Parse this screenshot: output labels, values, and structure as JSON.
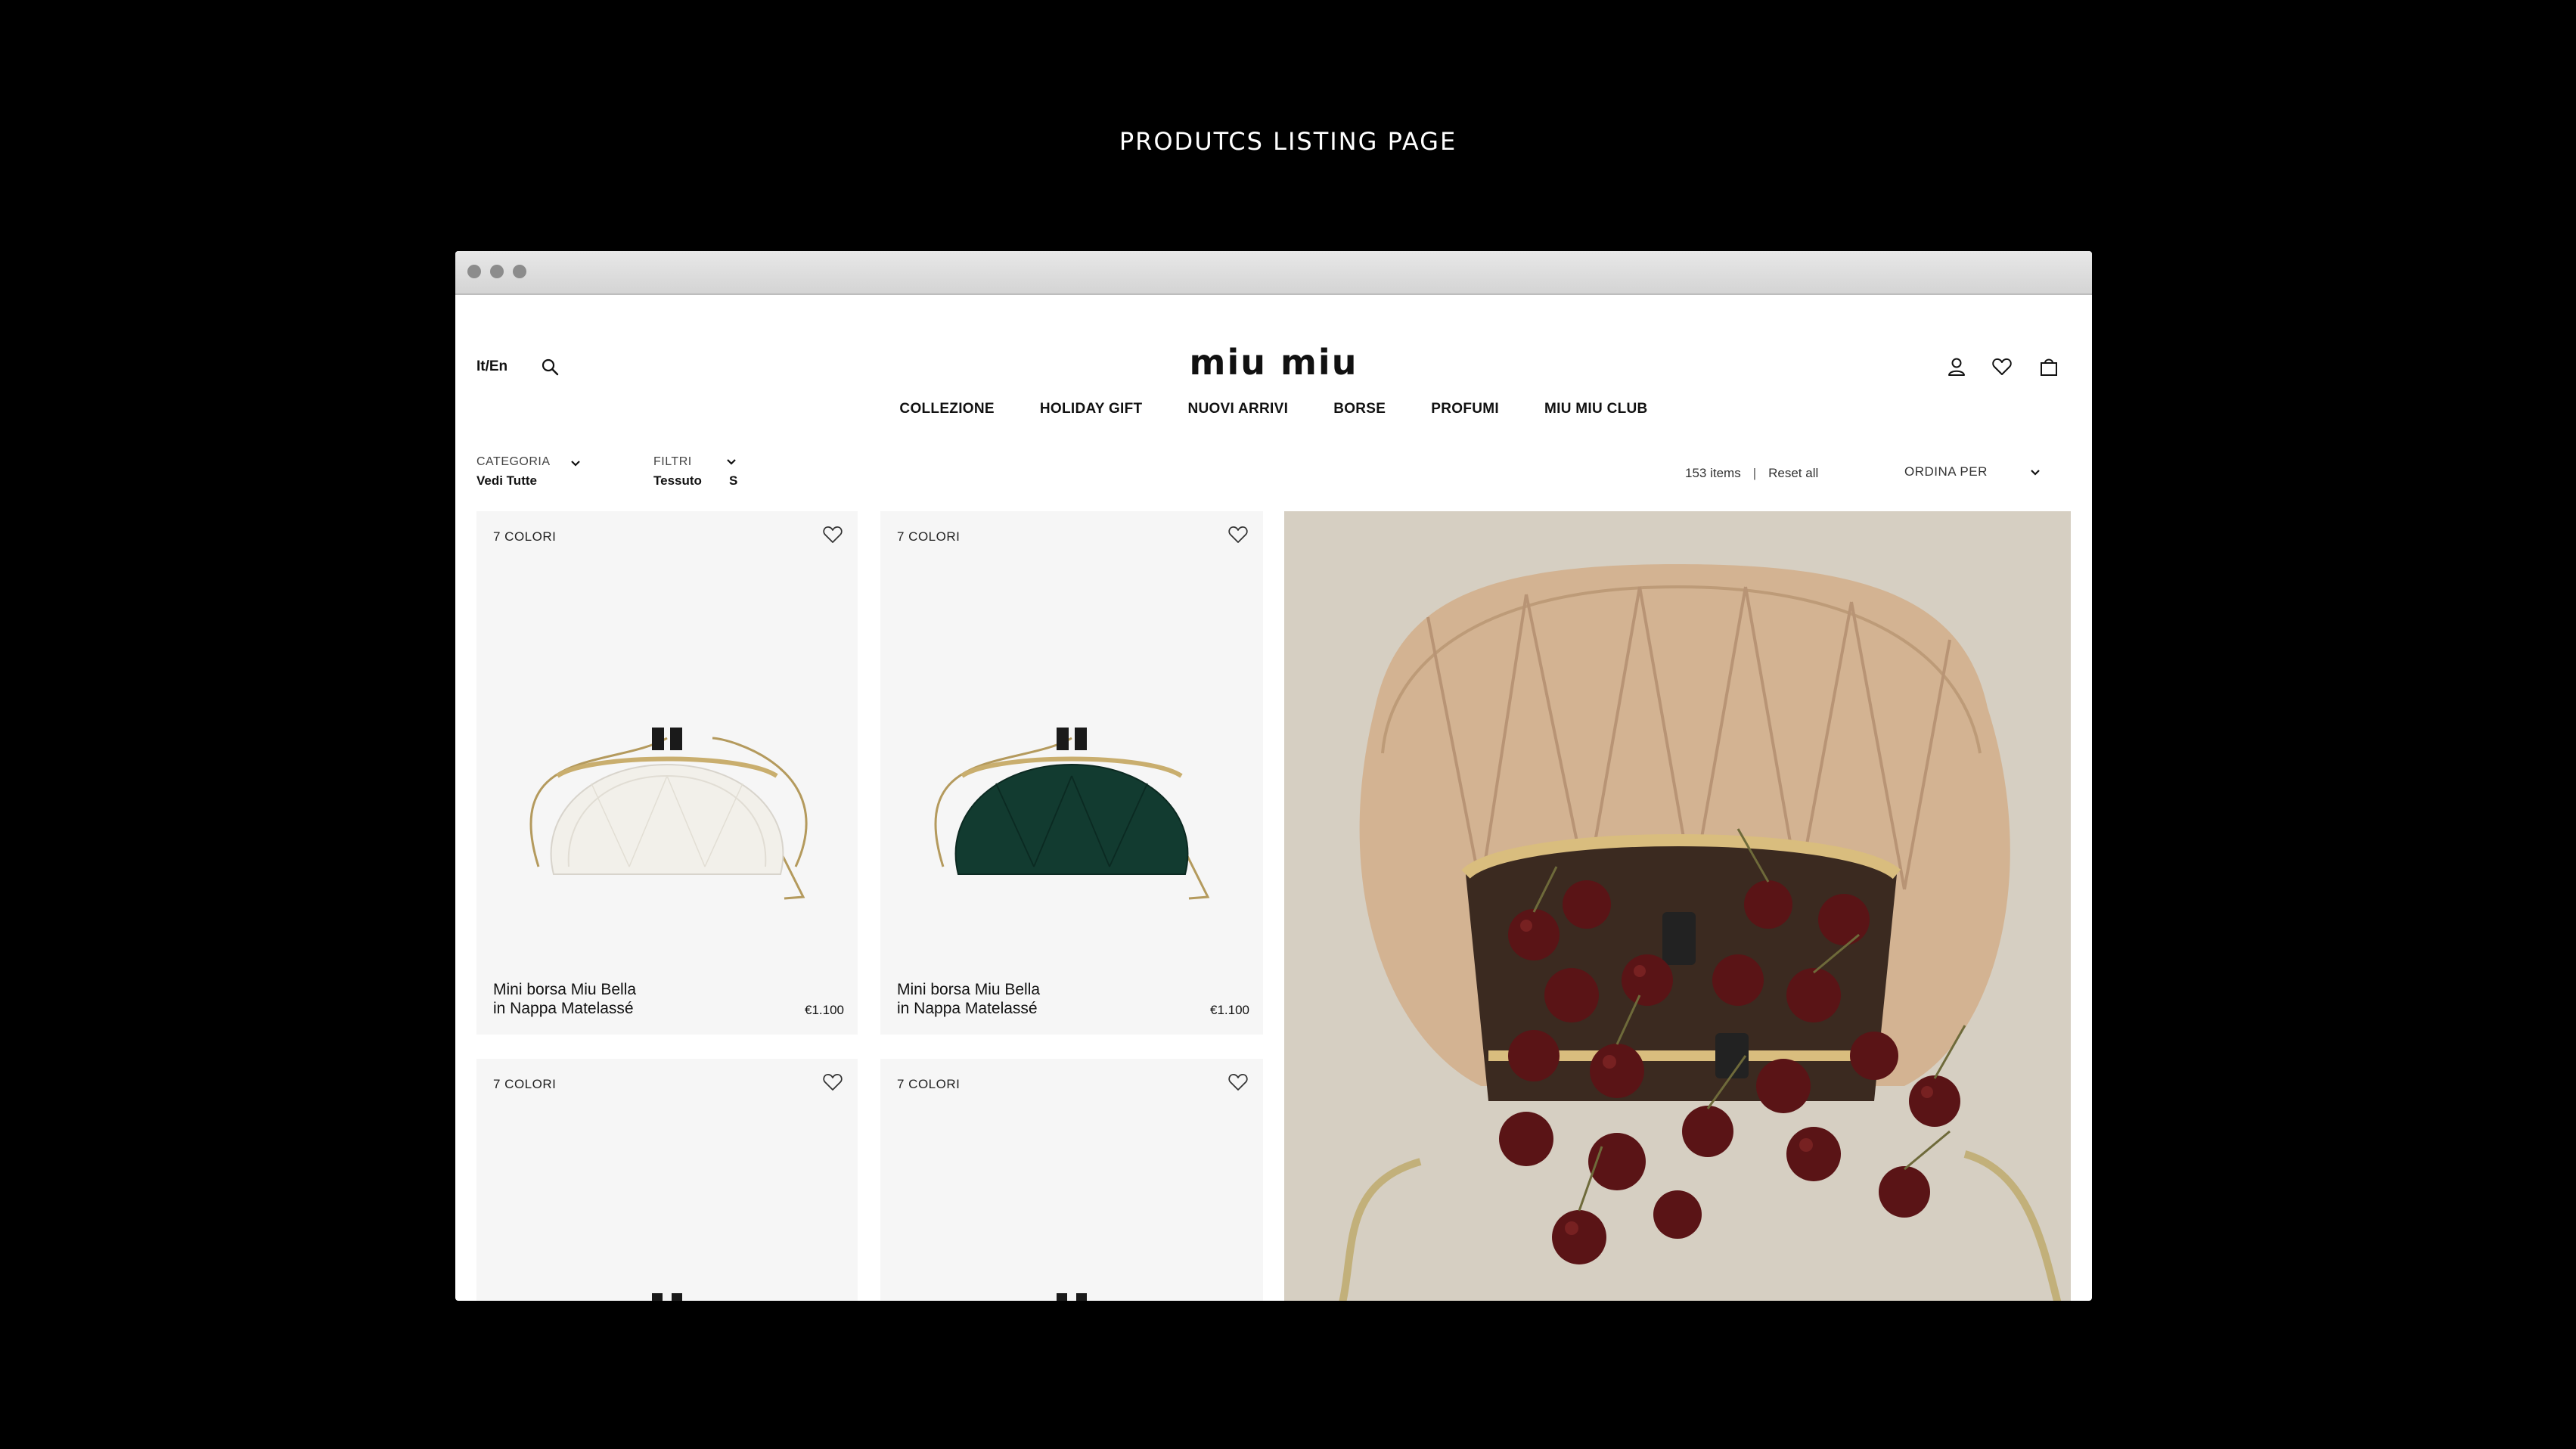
{
  "slide_title": "PRODUTCS LISTING PAGE",
  "header": {
    "lang": "It/En",
    "logo": "miu miu"
  },
  "nav": [
    {
      "label": "COLLEZIONE"
    },
    {
      "label": "HOLIDAY GIFT"
    },
    {
      "label": "NUOVI ARRIVI"
    },
    {
      "label": "BORSE"
    },
    {
      "label": "PROFUMI"
    },
    {
      "label": "MIU MIU CLUB"
    }
  ],
  "filters": {
    "category_label": "CATEGORIA",
    "category_value": "Vedi Tutte",
    "filters_label": "FILTRI",
    "filters_value": "Tessuto",
    "filters_size": "S"
  },
  "toolbar": {
    "items_count": "153 items",
    "separator": "|",
    "reset": "Reset all",
    "sort": "ORDINA PER"
  },
  "products": [
    {
      "colors": "7 COLORI",
      "name_line1": "Mini borsa Miu Bella",
      "name_line2": "in Nappa Matelassé",
      "price": "€1.100",
      "color": "#f2f0ea"
    },
    {
      "colors": "7 COLORI",
      "name_line1": "Mini borsa Miu Bella",
      "name_line2": "in Nappa Matelassé",
      "price": "€1.100",
      "color": "#123b30"
    },
    {
      "colors": "7 COLORI",
      "color": "#a5583a"
    },
    {
      "colors": "7 COLORI",
      "color": "#1d3f3a"
    }
  ],
  "icons": {
    "search": "search-icon",
    "account": "user-icon",
    "wishlist": "heart-icon",
    "bag": "shopping-bag-icon"
  }
}
